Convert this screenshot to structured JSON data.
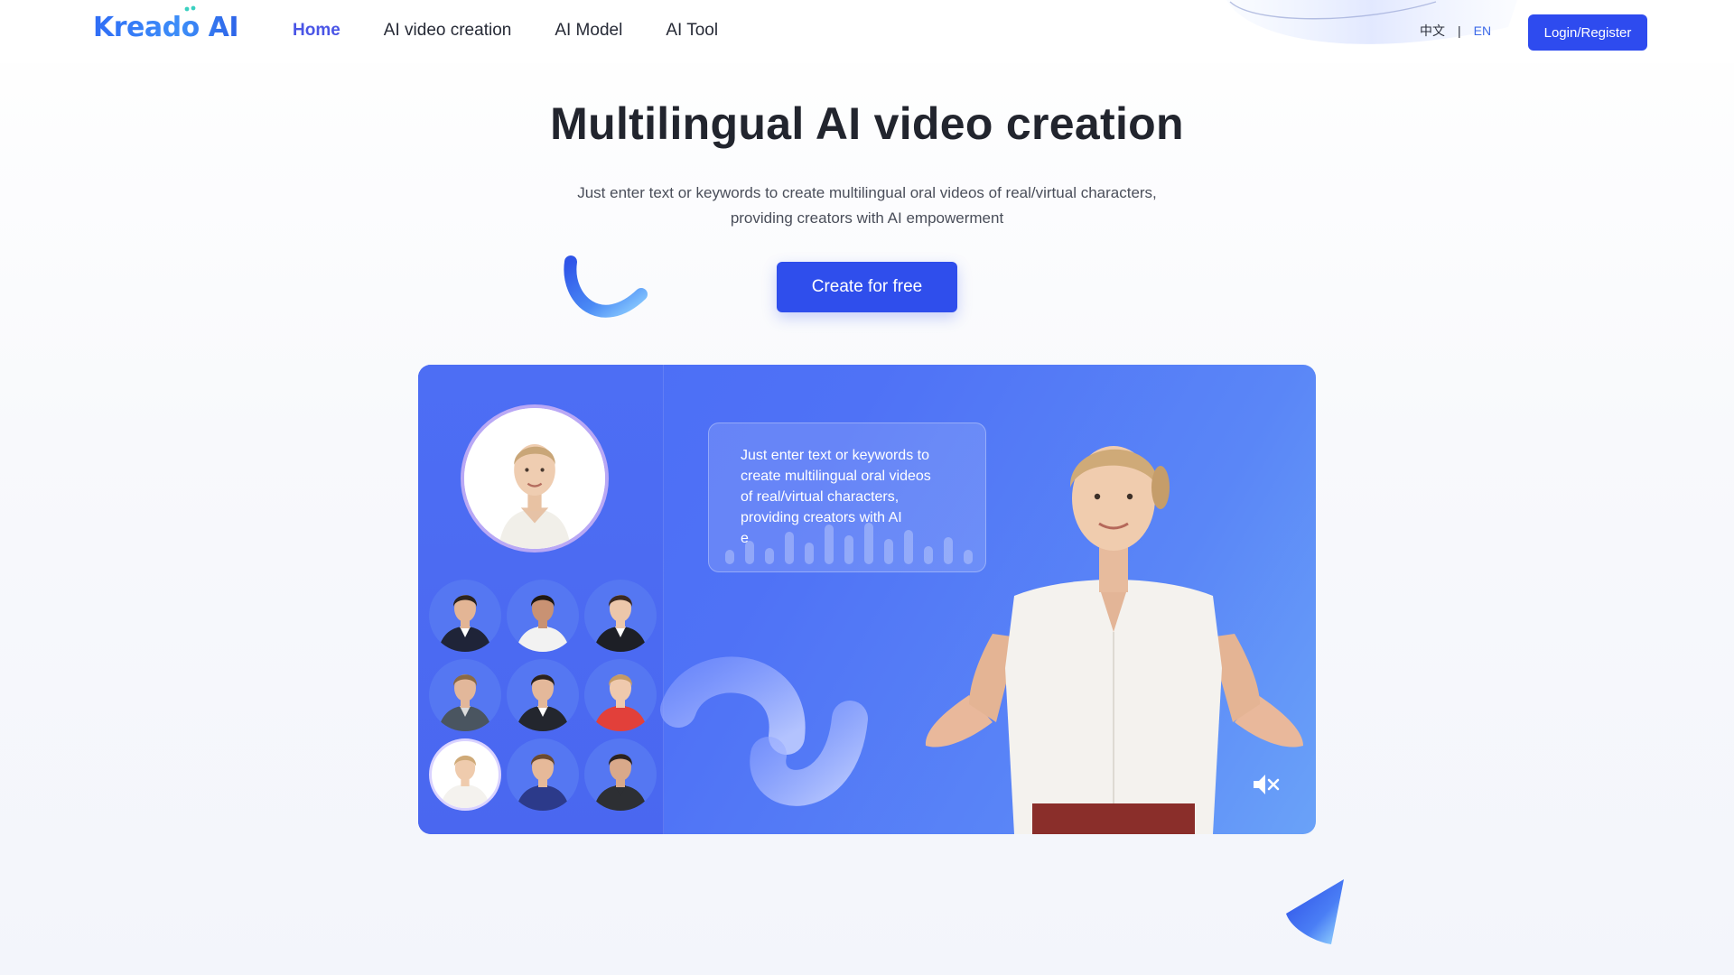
{
  "header": {
    "logo_text": "Kreado AI",
    "nav": [
      {
        "label": "Home",
        "active": true
      },
      {
        "label": "AI video creation",
        "active": false
      },
      {
        "label": "AI Model",
        "active": false
      },
      {
        "label": "AI Tool",
        "active": false
      }
    ],
    "lang_zh": "中文",
    "lang_sep": "|",
    "lang_en": "EN",
    "login_label": "Login/Register"
  },
  "hero": {
    "title": "Multilingual AI video creation",
    "subtitle_line1": "Just enter text or keywords to create multilingual oral videos of real/virtual characters,",
    "subtitle_line2": "providing creators with AI empowerment",
    "cta_label": "Create for free"
  },
  "demo": {
    "speech_lines": [
      "Just enter text or keywords to",
      "create multilingual oral videos",
      "of real/virtual characters,",
      "providing creators with AI",
      "e"
    ],
    "avatars": [
      {
        "id": "avatar-man-suit-1",
        "selected": false
      },
      {
        "id": "avatar-man-beard",
        "selected": false
      },
      {
        "id": "avatar-woman-blazer",
        "selected": false
      },
      {
        "id": "avatar-man-glasses",
        "selected": false
      },
      {
        "id": "avatar-man-suit-2",
        "selected": false
      },
      {
        "id": "avatar-woman-red",
        "selected": false
      },
      {
        "id": "avatar-woman-white",
        "selected": true
      },
      {
        "id": "avatar-man-blue",
        "selected": false
      },
      {
        "id": "avatar-man-dark",
        "selected": false
      }
    ]
  },
  "colors": {
    "brand_blue": "#2f4eec",
    "nav_active": "#4a55e6",
    "lang_active": "#3d6ae8",
    "panel_blue": "#4f72f6"
  },
  "icons": [
    "logo-dots-icon",
    "mute-speaker-icon"
  ]
}
